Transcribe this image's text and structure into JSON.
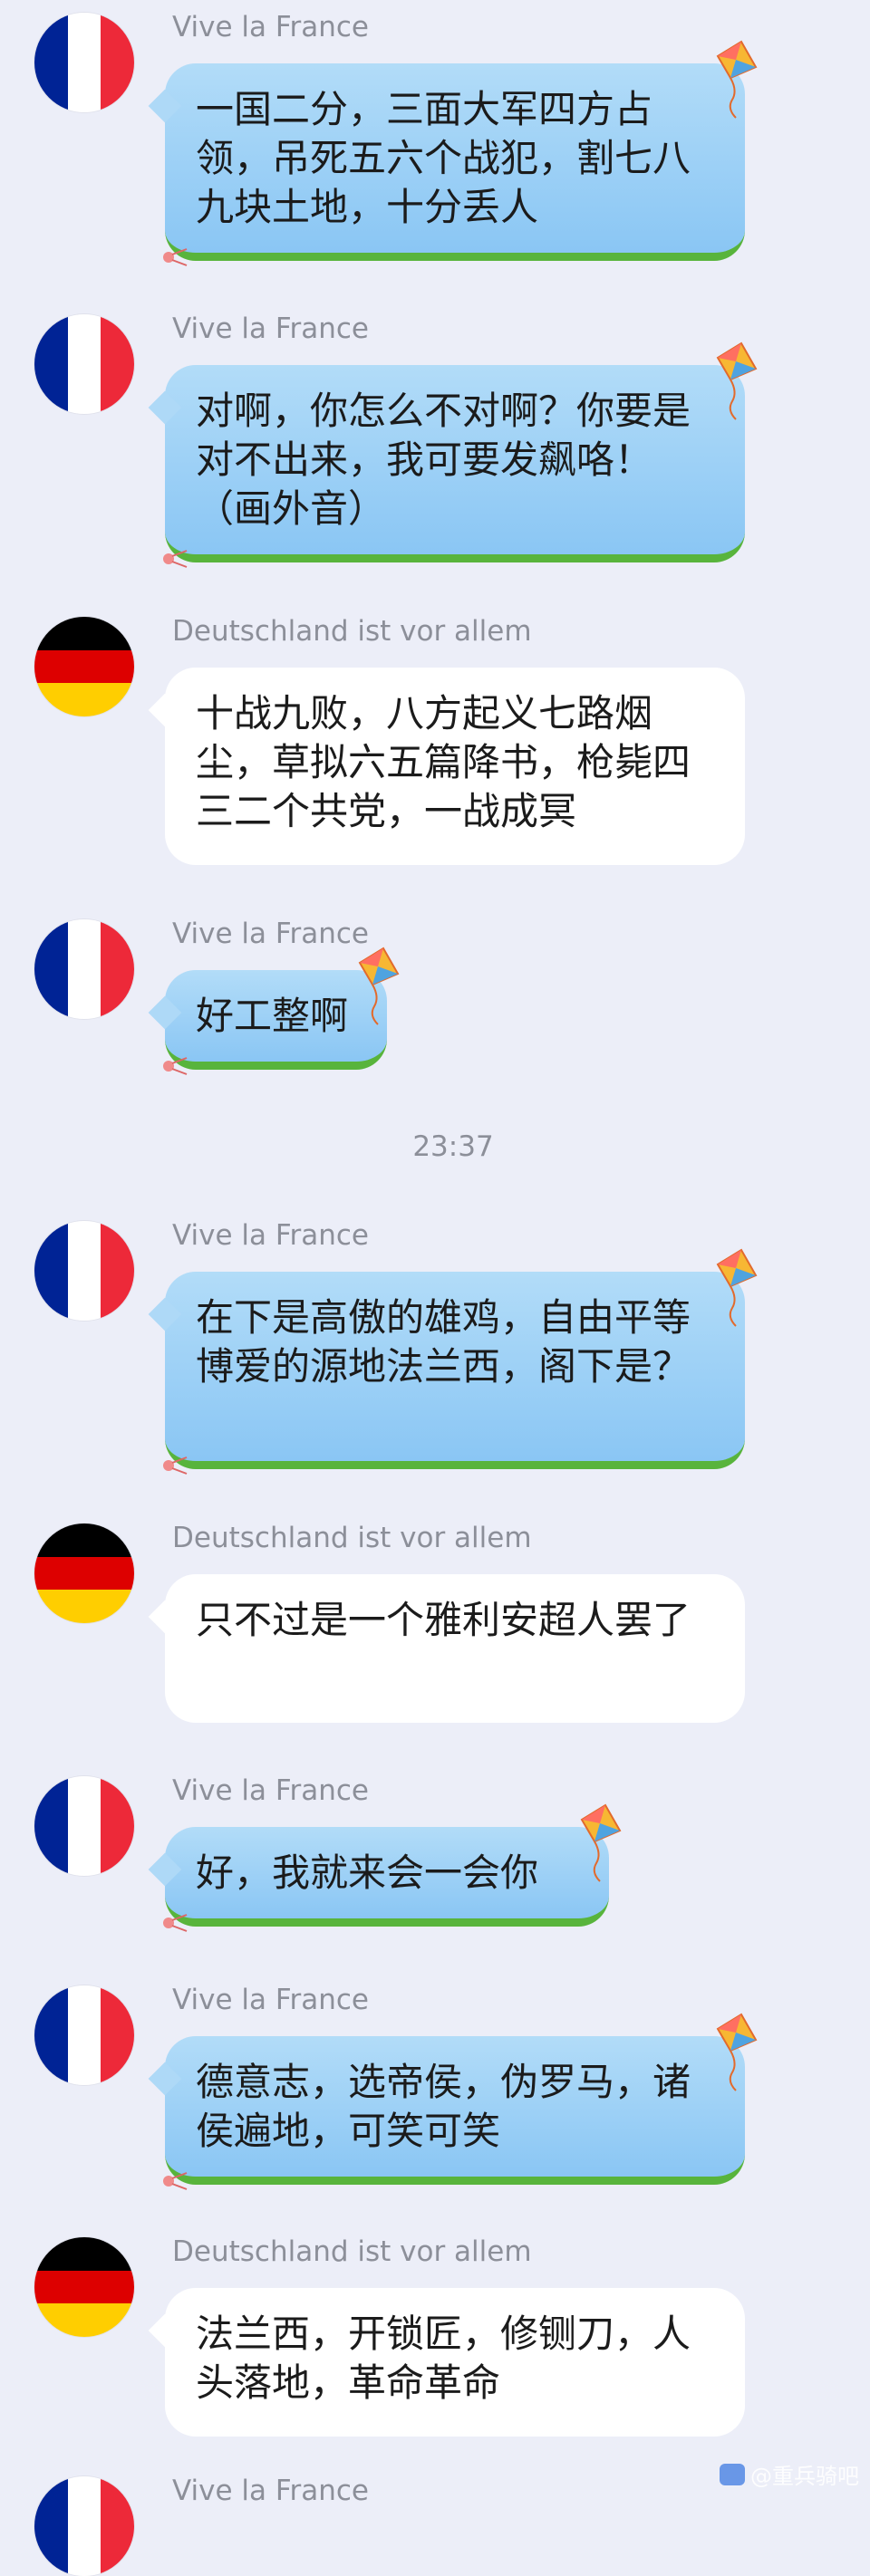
{
  "colors": {
    "france_blue": "#002395",
    "france_white": "#ffffff",
    "france_red": "#ed2939",
    "germany_black": "#000000",
    "germany_red": "#dd0000",
    "germany_gold": "#ffce00",
    "bubble_blue": "#9fd2f6",
    "bubble_green_base": "#58b43c"
  },
  "senders": {
    "france": "Vive la France",
    "germany": "Deutschland ist vor allem"
  },
  "messages": [
    {
      "sender": "Vive la France",
      "text": "一国二分，三面大军四方占领，吊死五六个战犯，割七八九块土地，十分丢人"
    },
    {
      "sender": "Vive la France",
      "text": "对啊，你怎么不对啊？你要是对不出来，我可要发飙咯！（画外音）"
    },
    {
      "sender": "Deutschland ist vor allem",
      "text": "十战九败，八方起义七路烟尘，草拟六五篇降书，枪毙四三二个共党，一战成冥"
    },
    {
      "sender": "Vive la France",
      "text": "好工整啊"
    },
    {
      "sender": "Vive la France",
      "text": "在下是高傲的雄鸡，自由平等博爱的源地法兰西，阁下是？"
    },
    {
      "sender": "Deutschland ist vor allem",
      "text": "只不过是一个雅利安超人罢了"
    },
    {
      "sender": "Vive la France",
      "text": "好，我就来会一会你"
    },
    {
      "sender": "Vive la France",
      "text": "德意志，选帝侯，伪罗马，诸侯遍地，可笑可笑"
    },
    {
      "sender": "Deutschland ist vor allem",
      "text": "法兰西，开锁匠，修铡刀，人头落地，革命革命"
    },
    {
      "sender": "Vive la France",
      "text": ""
    }
  ],
  "timestamp": "23:37",
  "watermark": "@重兵骑吧",
  "icons": [
    "france-flag-avatar",
    "germany-flag-avatar",
    "kite-icon",
    "bubble-deco-icon"
  ]
}
